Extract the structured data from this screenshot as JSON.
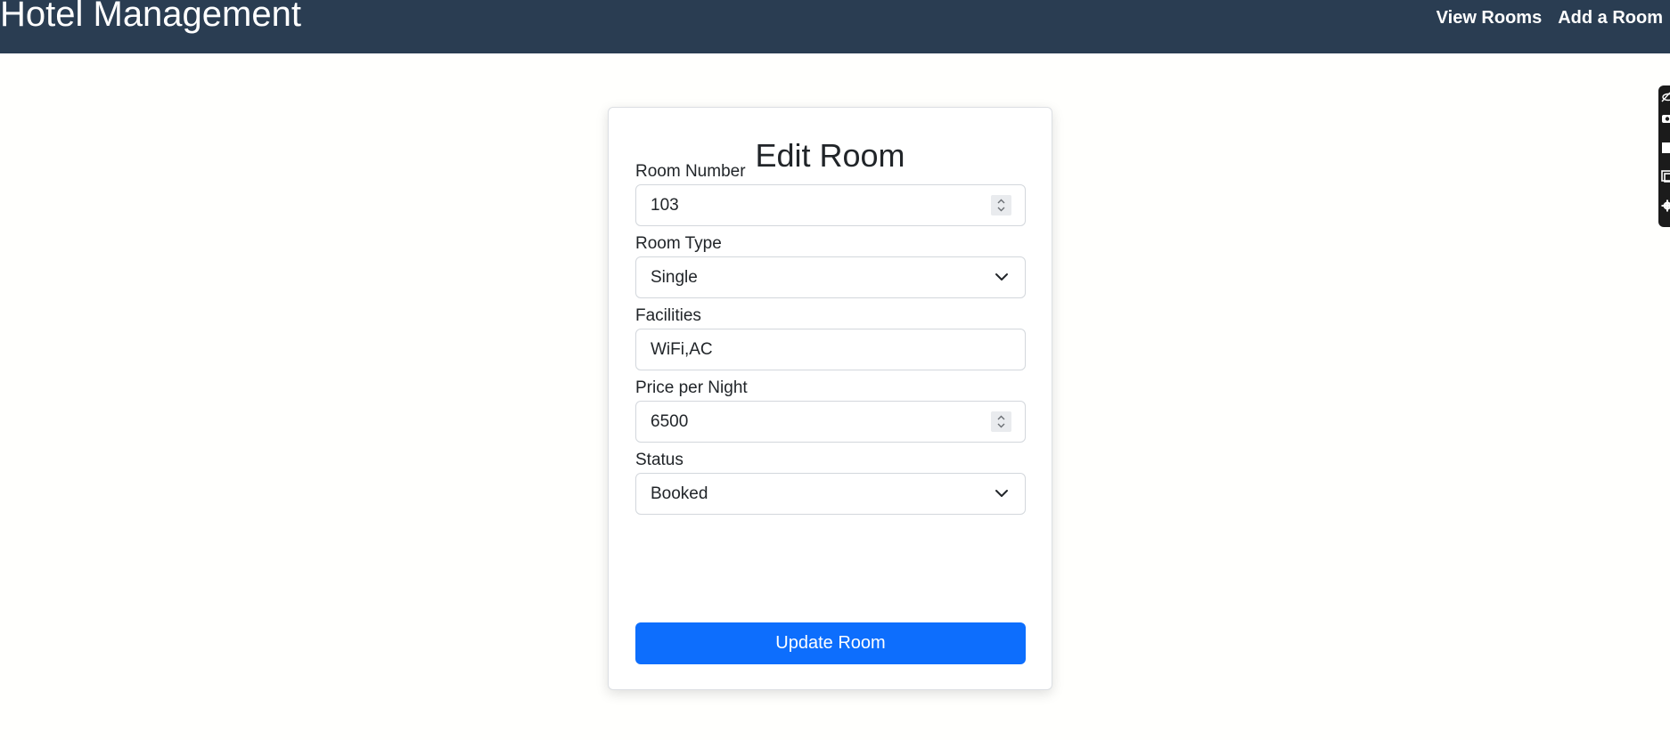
{
  "navbar": {
    "brand": "Hotel Management",
    "links": [
      "View Rooms",
      "Add a Room"
    ]
  },
  "form": {
    "title": "Edit Room",
    "fields": [
      {
        "label": "Room Number",
        "value": "103",
        "type": "number"
      },
      {
        "label": "Room Type",
        "value": "Single",
        "type": "select"
      },
      {
        "label": "Facilities",
        "value": "WiFi,AC",
        "type": "text"
      },
      {
        "label": "Price per Night",
        "value": "6500",
        "type": "number"
      },
      {
        "label": "Status",
        "value": "Booked",
        "type": "select"
      }
    ],
    "submit_label": "Update Room"
  },
  "side_toolbar": {
    "icons": [
      "eye-off-icon",
      "camera-icon",
      "square-icon",
      "copy-icon",
      "gear-icon"
    ]
  },
  "colors": {
    "navbar": "#2a3d52",
    "primary": "#0d6efd",
    "toolbar": "#1b1b1b"
  }
}
